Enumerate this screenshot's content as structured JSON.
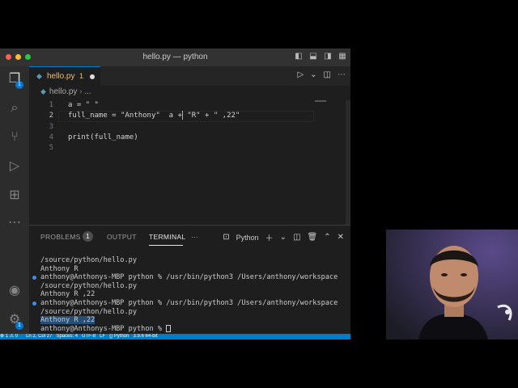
{
  "window": {
    "title": "hello.py — python"
  },
  "activity_bar": {
    "explorer_badge": "1",
    "settings_badge": "1"
  },
  "tab": {
    "label": "hello.py",
    "problems": "1"
  },
  "breadcrumb": {
    "file": "hello.py",
    "rest": "..."
  },
  "code": [
    {
      "num": "1",
      "text": "a = \" \""
    },
    {
      "num": "2",
      "text_before": "full_name = \"Anthony\"  a +",
      "text_after": " \"R\" + \" ,22\""
    },
    {
      "num": "3",
      "text": ""
    },
    {
      "num": "4",
      "text": "print(full_name)"
    },
    {
      "num": "5",
      "text": ""
    }
  ],
  "panel": {
    "tabs": {
      "problems": "PROBLEMS",
      "problems_count": "1",
      "output": "OUTPUT",
      "terminal": "TERMINAL"
    },
    "terminal_name": "Python",
    "lines": [
      {
        "text": "/source/python/hello.py",
        "dot": false
      },
      {
        "text": "Anthony R",
        "dot": false
      },
      {
        "text": "anthony@Anthonys-MBP python % /usr/bin/python3 /Users/anthony/workspace",
        "dot": true
      },
      {
        "text": "/source/python/hello.py",
        "dot": false
      },
      {
        "text": "Anthony R ,22",
        "dot": false
      },
      {
        "text": "anthony@Anthonys-MBP python % /usr/bin/python3 /Users/anthony/workspace",
        "dot": true
      },
      {
        "text": "/source/python/hello.py",
        "dot": false
      },
      {
        "text": "Anthony R ,22",
        "dot": false,
        "selected": true
      }
    ],
    "prompt": "anthony@Anthonys-MBP python % "
  },
  "status_bar": {
    "text": "⊗ 1 ⚠ 0      Ln 2, Col 27   Spaces: 4   UTF-8   LF   {} Python   3.9.6 64-bit"
  },
  "colors": {
    "accent": "#007acc",
    "editor_bg": "#1e1e1e"
  },
  "icons": [
    "files-icon",
    "search-icon",
    "source-control-icon",
    "run-debug-icon",
    "extensions-icon",
    "more-icon",
    "account-icon",
    "settings-gear-icon"
  ]
}
